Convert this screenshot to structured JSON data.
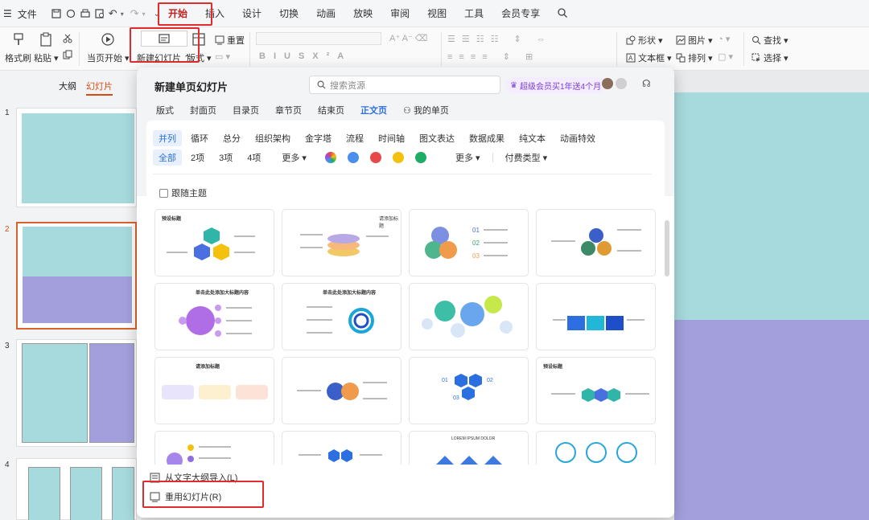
{
  "menubar": {
    "file_label": "文件",
    "tabs": [
      "开始",
      "插入",
      "设计",
      "切换",
      "动画",
      "放映",
      "审阅",
      "视图",
      "工具",
      "会员专享"
    ]
  },
  "ribbon": {
    "format_painter": "格式刷",
    "paste": "粘贴",
    "from_current": "当页开始",
    "new_slide": "新建幻灯片",
    "layout": "版式",
    "reset": "重置",
    "shape": "形状",
    "picture": "图片",
    "find": "查找",
    "textbox": "文本框",
    "arrange": "排列",
    "select": "选择"
  },
  "left_panel": {
    "tabs": [
      "大纲",
      "幻灯片"
    ],
    "slide_numbers": [
      "1",
      "2",
      "3",
      "4"
    ]
  },
  "popup": {
    "title": "新建单页幻灯片",
    "search_placeholder": "搜索资源",
    "vip_promo": "超级会员买1年送4个月",
    "tabs": [
      "版式",
      "封面页",
      "目录页",
      "章节页",
      "结束页",
      "正文页",
      "我的单页"
    ],
    "categories": [
      "并列",
      "循环",
      "总分",
      "组织架构",
      "金字塔",
      "流程",
      "时间轴",
      "图文表达",
      "数据成果",
      "纯文本",
      "动画特效"
    ],
    "counts": [
      "全部",
      "2项",
      "3项",
      "4项"
    ],
    "more_label": "更多",
    "more_label_2": "更多",
    "pay_type_label": "付费类型",
    "color_filters": [
      "#4a8ef0",
      "#e84848",
      "#f4c20d",
      "#1fad66"
    ],
    "follow_theme": "跟随主题",
    "footer": {
      "import_outline": "从文字大纲导入(L)",
      "reuse_slides": "重用幻灯片(R)"
    },
    "card_captions": [
      "预设标题",
      "请添加标题",
      "单击此处添加大标题内容",
      "单击此处添加大标题内容",
      "请添加标题",
      "单击此处添加大标题",
      "预设标题",
      "LOREM IPSUM DOLOR"
    ]
  }
}
